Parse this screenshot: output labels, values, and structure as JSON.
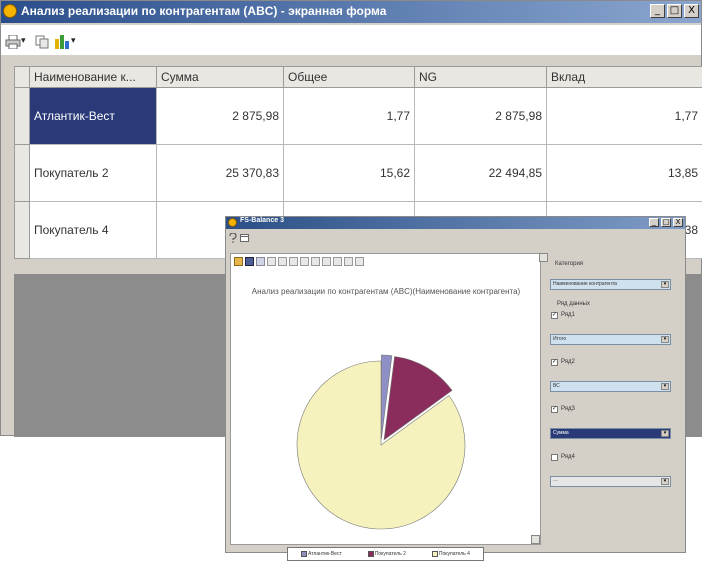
{
  "window": {
    "title": "Анализ реализации по контрагентам (ABC) - экранная форма",
    "min": "_",
    "max": "□",
    "close": "X"
  },
  "toolbar": {
    "print_icon": "printer-icon",
    "copy_icon": "copy-icon",
    "chart_icon": "chart-icon",
    "dropdown_glyph": "▾"
  },
  "table": {
    "columns": [
      "Наименование к...",
      "Сумма",
      "Общее",
      "NG",
      "Вклад"
    ],
    "rows": [
      {
        "name": "Атлантик-Вест",
        "sum": "2 875,98",
        "total": "1,77",
        "ng": "2 875,98",
        "share": "1,77"
      },
      {
        "name": "Покупатель 2",
        "sum": "25 370,83",
        "total": "15,62",
        "ng": "22 494,85",
        "share": "13,85"
      },
      {
        "name": "Покупатель 4",
        "sum": "",
        "total": "",
        "ng": "",
        "share": ",38"
      }
    ]
  },
  "chart_window": {
    "title": "FS-Balance 3",
    "min": "_",
    "max": "□",
    "close": "X",
    "toolbar_icon": "question-icon"
  },
  "side_panel": {
    "category_label": "Категория",
    "category_value": "Наименование контрагента",
    "data_rows_label": "Ряд данных",
    "series": [
      {
        "label": "Ряд1",
        "checked": true,
        "value": "Итого"
      },
      {
        "label": "Ряд2",
        "checked": true,
        "value": "ВС"
      },
      {
        "label": "Ряд3",
        "checked": true,
        "value": "Сумма"
      },
      {
        "label": "Ряд4",
        "checked": false,
        "value": "—"
      }
    ]
  },
  "chart_data": {
    "type": "pie",
    "title": "Анализ реализации по контрагентам (ABC)(Наименование контрагента)",
    "categories": [
      "Атлантик-Вест",
      "Покупатель 2",
      "Покупатель 4"
    ],
    "values": [
      2,
      13,
      85
    ],
    "colors": [
      "#8e8fc5",
      "#8b2d5c",
      "#f6f2be"
    ],
    "legend_position": "bottom"
  }
}
